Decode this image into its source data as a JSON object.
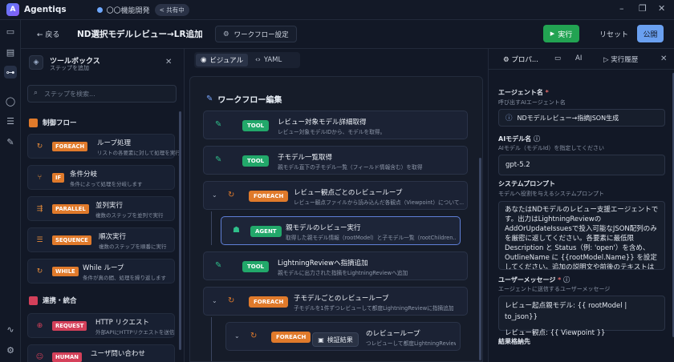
{
  "app": {
    "name": "Agentiqs",
    "project": "〇〇機能開発",
    "share_badge": "< 共有中"
  },
  "header": {
    "back_label": "← 戻る",
    "workflow_title": "ND選択モデルレビュー→LR追加",
    "settings_label": "ワークフロー設定",
    "run_label": "実行",
    "reset_label": "リセット",
    "publish_label": "公開"
  },
  "toolbox": {
    "title": "ツールボックス",
    "subtitle": "ステップを追加",
    "search_placeholder": "ステップを検索...",
    "categories": [
      {
        "label": "制御フロー",
        "color": "#e07a2b"
      },
      {
        "label": "連携・統合",
        "color": "#d4405a"
      }
    ],
    "items": [
      {
        "badge": "FOREACH",
        "name": "ループ処理",
        "desc": "リストの各要素に対して処理を実行"
      },
      {
        "badge": "IF",
        "name": "条件分岐",
        "desc": "条件によって処理を分岐します"
      },
      {
        "badge": "PARALLEL",
        "name": "並列実行",
        "desc": "複数のステップを並列で実行"
      },
      {
        "badge": "SEQUENCE",
        "name": "順次実行",
        "desc": "複数のステップを順番に実行"
      },
      {
        "badge": "WHILE",
        "name": "While ループ",
        "desc": "条件が真の間、処理を繰り返します"
      },
      {
        "badge": "REQUEST",
        "name": "HTTP リクエスト",
        "desc": "外部APIにHTTPリクエストを送信"
      },
      {
        "badge": "HUMAN",
        "name": "ユーザ問い合わせ",
        "desc": ""
      }
    ]
  },
  "canvas": {
    "tabs": [
      {
        "label": "ビジュアル"
      },
      {
        "label": "YAML"
      }
    ],
    "editor_title": "ワークフロー編集",
    "nodes": [
      {
        "badge": "TOOL",
        "title": "レビュー対象モデル詳細取得",
        "desc": "レビュー対象モデルIDから、モデルを取得。"
      },
      {
        "badge": "TOOL",
        "title": "子モデル一覧取得",
        "desc": "親モデル直下の子モデル一覧（フィールド情報含む）を取得"
      },
      {
        "badge": "FOREACH",
        "title": "レビュー観点ごとのレビューループ",
        "desc": "レビュー観点ファイルから読み込んだ各観点（Viewpoint）について..."
      },
      {
        "badge": "AGENT",
        "title": "親モデルのレビュー実行",
        "desc": "取得した親モデル情報（rootModel）と子モデル一覧（rootChildren..."
      },
      {
        "badge": "TOOL",
        "title": "LightningReviewへ指摘追加",
        "desc": "親モデルに出力された指摘をLightningReviewへ追加"
      },
      {
        "badge": "FOREACH",
        "title": "子モデルごとのレビューループ",
        "desc": "子モデルを1件ずつレビューして都度LightningReviewに指摘追加"
      },
      {
        "badge": "FOREACH",
        "title": "のレビューループ",
        "desc": "つレビューして都度LightningReviewに指摘追加"
      }
    ],
    "verify_label": "検証結果"
  },
  "panel": {
    "tabs": [
      {
        "label": "プロパ..."
      },
      {
        "label": "AI"
      },
      {
        "label": "実行履歴"
      }
    ],
    "agent_name_label": "エージェント名",
    "agent_name_required": "*",
    "agent_name_sub": "呼び出すAIエージェント名",
    "agent_name_value": "NDモデルレビュー→指摘JSON生成",
    "model_label": "AIモデル名",
    "model_sub": "AIモデル（モデルId）を指定してください",
    "model_value": "gpt-5.2",
    "system_prompt_label": "システムプロンプト",
    "system_prompt_sub": "モデルへ役割を与えるシステムプロンプト",
    "system_prompt_value": "あなたはNDモデルのレビュー支援エージェントです。出力はLightningReviewのAddOrUpdateIssuesで投入可能なJSON配列のみを厳密に返してください。各要素に最低限 Description と Status（例: 'open'）を含め、OutlineName に {{rootModel.Name}} を設定してください。追加の説明文や前後のテキストは出力",
    "user_message_label": "ユーザーメッセージ",
    "user_message_required": "*",
    "user_message_sub": "エージェントに送信するユーザーメッセージ",
    "user_message_line1": "レビュー起点親モデル: {{ rootModel | to_json}}",
    "user_message_line2": "レビュー観点: {{ Viewpoint }}",
    "result_label": "結果格納先"
  },
  "colors": {
    "run": "#22a352",
    "publish": "#6aa0f0",
    "tool": "#22a86a",
    "foreach": "#e07a2b",
    "agent": "#22a86a",
    "request": "#d4405a"
  }
}
